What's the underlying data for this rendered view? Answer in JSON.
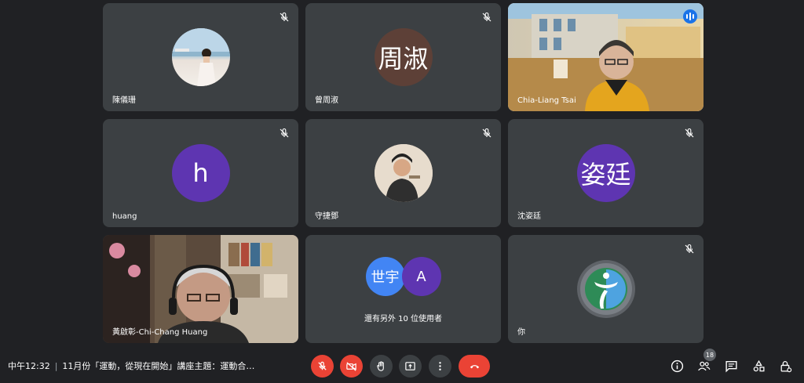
{
  "tiles": [
    {
      "name": "陳儀珊",
      "avatar_type": "photo",
      "muted": true
    },
    {
      "name": "曾周淑",
      "avatar_text": "周淑",
      "avatar_color": "#5d4037",
      "muted": true
    },
    {
      "name": "Chia-Liang Tsai",
      "avatar_type": "video",
      "speaking": true
    },
    {
      "name": "huang",
      "avatar_text": "h",
      "avatar_color": "#5e35b1",
      "muted": true
    },
    {
      "name": "守捷鄧",
      "avatar_type": "photo",
      "muted": true
    },
    {
      "name": "沈姿廷",
      "avatar_text": "姿廷",
      "avatar_color": "#5e35b1",
      "muted": true
    },
    {
      "name": "黃啟彰-Chi-Chang Huang",
      "avatar_type": "video"
    },
    {
      "group_avatars": [
        "世宇",
        "A"
      ],
      "group_colors": [
        "#4285f4",
        "#5e35b1"
      ],
      "more_text": "還有另外 10 位使用者"
    },
    {
      "name": "你",
      "avatar_type": "logo",
      "muted": true
    }
  ],
  "bottom": {
    "time": "中午12:32",
    "separator": "|",
    "meeting_title": "11月份「運動，從現在開始」講座主題：運動合…",
    "participant_count": "18"
  },
  "icons": {
    "mic": "mic-off-icon",
    "camera": "camera-off-icon",
    "hand": "raise-hand-icon",
    "present": "present-screen-icon",
    "more": "more-options-icon",
    "hangup": "hang-up-icon",
    "info": "info-icon",
    "people": "people-icon",
    "chat": "chat-icon",
    "activities": "activities-icon",
    "host": "host-controls-icon"
  },
  "colors": {
    "danger": "#ea4335",
    "tile": "#3c4043",
    "background": "#202124",
    "speaking_outline": "#8ab4f8"
  }
}
